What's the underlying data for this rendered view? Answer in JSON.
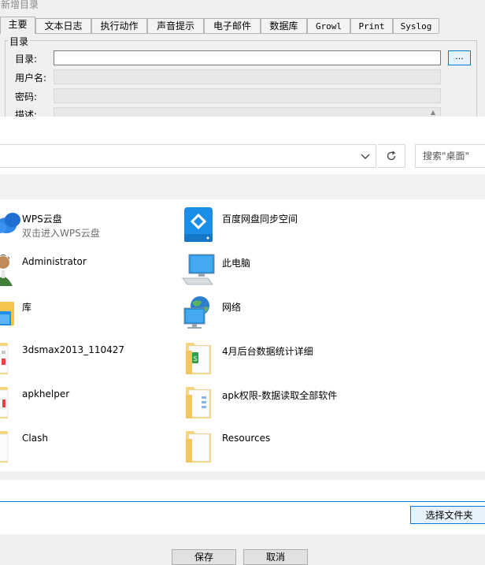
{
  "window": {
    "title": "新增目录"
  },
  "tabs": [
    {
      "label": "主要"
    },
    {
      "label": "文本日志"
    },
    {
      "label": "执行动作"
    },
    {
      "label": "声音提示"
    },
    {
      "label": "电子邮件"
    },
    {
      "label": "数据库"
    },
    {
      "label": "Growl"
    },
    {
      "label": "Print"
    },
    {
      "label": "Syslog"
    }
  ],
  "group": {
    "title": "目录"
  },
  "form": {
    "dir_label": "目录:",
    "dir_value": "",
    "browse_label": "...",
    "user_label": "用户名:",
    "password_label": "密码:",
    "desc_label": "描述:"
  },
  "picker": {
    "search_placeholder": "搜索\"桌面\"",
    "refresh_icon": "refresh-icon",
    "items": [
      {
        "name": "WPS云盘",
        "sub": "双击进入WPS云盘",
        "icon": "cloud-icon"
      },
      {
        "name": "百度网盘同步空间",
        "sub": "",
        "icon": "baidu-netdisk-icon"
      },
      {
        "name": "Administrator",
        "sub": "",
        "icon": "user-icon"
      },
      {
        "name": "此电脑",
        "sub": "",
        "icon": "computer-icon"
      },
      {
        "name": "库",
        "sub": "",
        "icon": "library-icon"
      },
      {
        "name": "网络",
        "sub": "",
        "icon": "network-icon"
      },
      {
        "name": "3dsmax2013_110427",
        "sub": "",
        "icon": "folder-icon"
      },
      {
        "name": "4月后台数据统计详细",
        "sub": "",
        "icon": "folder-icon"
      },
      {
        "name": "apkhelper",
        "sub": "",
        "icon": "folder-icon"
      },
      {
        "name": "apk权限-数据读取全部软件",
        "sub": "",
        "icon": "folder-icon"
      },
      {
        "name": "Clash",
        "sub": "",
        "icon": "folder-icon"
      },
      {
        "name": "Resources",
        "sub": "",
        "icon": "folder-icon"
      }
    ],
    "select_button": "选择文件夹"
  },
  "footer": {
    "save": "保存",
    "cancel": "取消"
  },
  "colors": {
    "accent": "#0078d7",
    "folder": "#f7d67a",
    "band": "#f2f2f2"
  }
}
